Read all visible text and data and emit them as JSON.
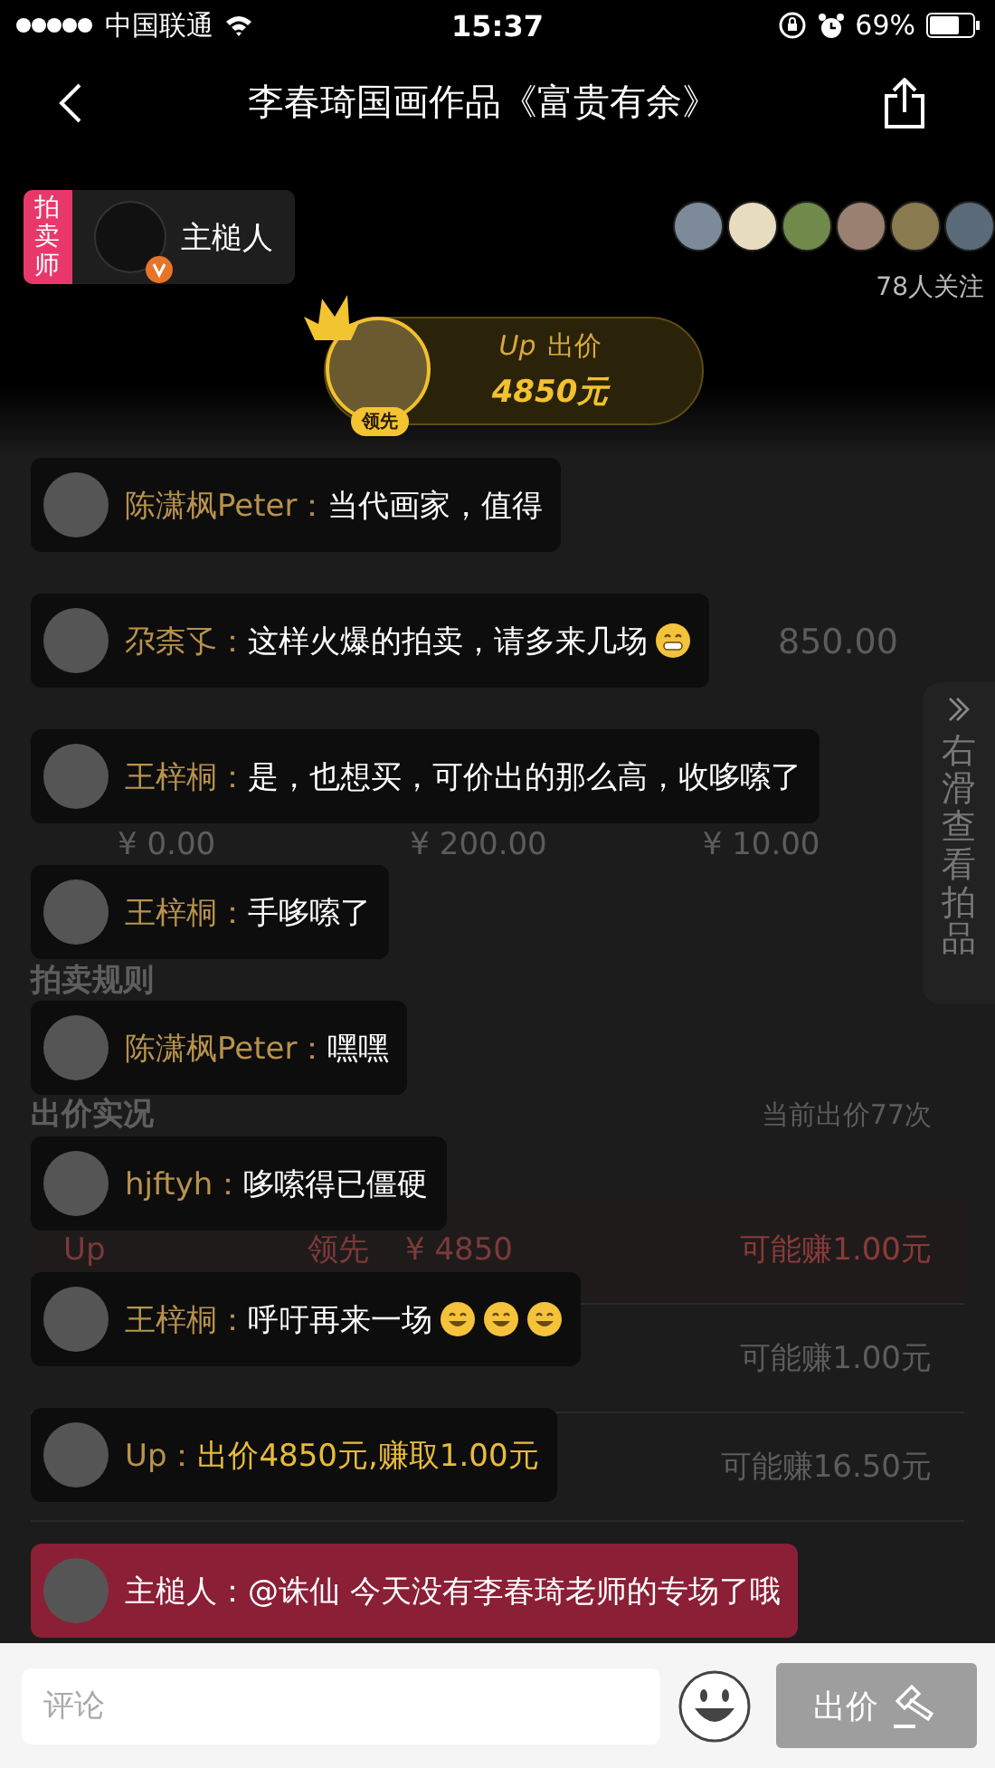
{
  "status_bar": {
    "carrier": "中国联通",
    "time": "15:37",
    "battery": "69%"
  },
  "nav": {
    "title": "李春琦国画作品《富贵有余》"
  },
  "host": {
    "tag": "拍卖师",
    "name": "主槌人",
    "verified": true
  },
  "followers": {
    "count_label": "78人关注",
    "avatars": [
      {
        "color": "#7d8a9a"
      },
      {
        "color": "#e8dcc0"
      },
      {
        "color": "#6f8a4a"
      },
      {
        "color": "#9a8070"
      },
      {
        "color": "#8a7a50"
      },
      {
        "color": "#5a6a78"
      }
    ]
  },
  "leading_bid": {
    "badge": "领先",
    "bidder": "Up",
    "action": "出价",
    "amount": "4850元"
  },
  "auction_page": {
    "price_partial": "850.00",
    "price_steps": [
      "¥ 0.00",
      "¥ 200.00",
      "¥ 10.00"
    ],
    "rules_heading": "拍卖规则",
    "bids_heading": "出价实况",
    "bid_count": "当前出价77次",
    "bid_rows": [
      {
        "bidder": "Up",
        "status": "领先",
        "amount": "¥ 4850",
        "earning": "可能赚1.00元",
        "leading": true
      },
      {
        "earning": "可能赚1.00元",
        "leading": false
      },
      {
        "earning": "可能赚16.50元",
        "leading": false
      }
    ]
  },
  "side_tab": {
    "label": "右滑查看拍品"
  },
  "messages": [
    {
      "kind": "comment",
      "user": "陈潇枫Peter：",
      "text": "当代画家，值得"
    },
    {
      "kind": "comment",
      "user": "尕柰孓：",
      "text": "这样火爆的拍卖，请多来几场",
      "emojis": [
        {
          "kind": "grin"
        }
      ]
    },
    {
      "kind": "comment",
      "user": "王梓桐：",
      "text": "是，也想买，可价出的那么高，收哆嗦了"
    },
    {
      "kind": "comment",
      "user": "王梓桐：",
      "text": "手哆嗦了"
    },
    {
      "kind": "comment",
      "user": "陈潇枫Peter：",
      "text": "嘿嘿"
    },
    {
      "kind": "comment",
      "user": "hjftyh：",
      "text": "哆嗦得已僵硬"
    },
    {
      "kind": "comment",
      "user": "王梓桐：",
      "text": "呼吁再来一场",
      "emojis": [
        {
          "kind": "smile"
        },
        {
          "kind": "smile"
        },
        {
          "kind": "smile"
        }
      ]
    },
    {
      "kind": "bid",
      "user": "Up：",
      "text": "出价4850元,赚取1.00元"
    },
    {
      "kind": "host",
      "user": "主槌人：",
      "text": "@诛仙 今天没有李春琦老师的专场了哦"
    }
  ],
  "composer": {
    "placeholder": "评论",
    "bid_button": "出价"
  }
}
